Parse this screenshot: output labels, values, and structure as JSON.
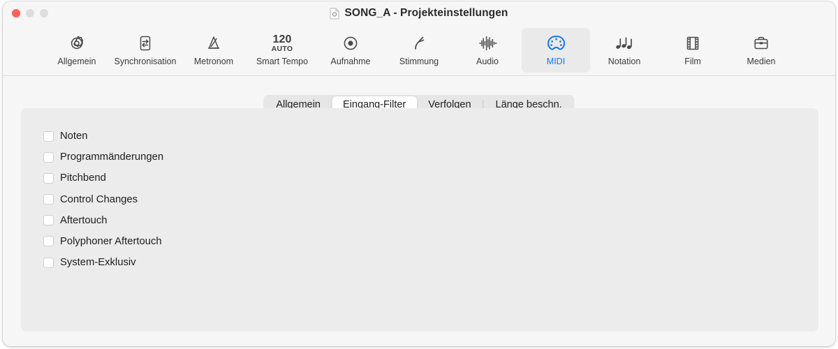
{
  "window": {
    "title": "SONG_A - Projekteinstellungen",
    "doc_icon": "document-icon",
    "traffic_lights": [
      {
        "name": "close-button",
        "color": "#ff6058"
      },
      {
        "name": "minimize-button",
        "color": "#dddddd"
      },
      {
        "name": "zoom-button",
        "color": "#dddddd"
      }
    ]
  },
  "toolbar": {
    "items": [
      {
        "label": "Allgemein",
        "icon": "gear-icon",
        "selected": false
      },
      {
        "label": "Synchronisation",
        "icon": "sync-arrows-icon",
        "selected": false
      },
      {
        "label": "Metronom",
        "icon": "metronome-icon",
        "selected": false
      },
      {
        "label": "Smart Tempo",
        "icon": "tempo-text-icon",
        "selected": false,
        "tempo_value": "120",
        "tempo_mode": "AUTO"
      },
      {
        "label": "Aufnahme",
        "icon": "record-circle-icon",
        "selected": false
      },
      {
        "label": "Stimmung",
        "icon": "tuning-fork-icon",
        "selected": false
      },
      {
        "label": "Audio",
        "icon": "waveform-icon",
        "selected": false
      },
      {
        "label": "MIDI",
        "icon": "midi-din-icon",
        "selected": true
      },
      {
        "label": "Notation",
        "icon": "music-notes-icon",
        "selected": false
      },
      {
        "label": "Film",
        "icon": "film-strip-icon",
        "selected": false
      },
      {
        "label": "Medien",
        "icon": "briefcase-icon",
        "selected": false
      }
    ],
    "accent_color": "#1478f0"
  },
  "segmented_control": {
    "tabs": [
      {
        "label": "Allgemein",
        "active": false,
        "divider_before": false
      },
      {
        "label": "Eingang-Filter",
        "active": true,
        "divider_before": false
      },
      {
        "label": "Verfolgen",
        "active": false,
        "divider_before": false
      },
      {
        "label": "Länge beschn.",
        "active": false,
        "divider_before": true
      }
    ]
  },
  "panel": {
    "checkboxes": [
      {
        "label": "Noten",
        "checked": false
      },
      {
        "label": "Programmänderungen",
        "checked": false
      },
      {
        "label": "Pitchbend",
        "checked": false
      },
      {
        "label": "Control Changes",
        "checked": false
      },
      {
        "label": "Aftertouch",
        "checked": false
      },
      {
        "label": "Polyphoner Aftertouch",
        "checked": false
      },
      {
        "label": "System-Exklusiv",
        "checked": false
      }
    ]
  }
}
